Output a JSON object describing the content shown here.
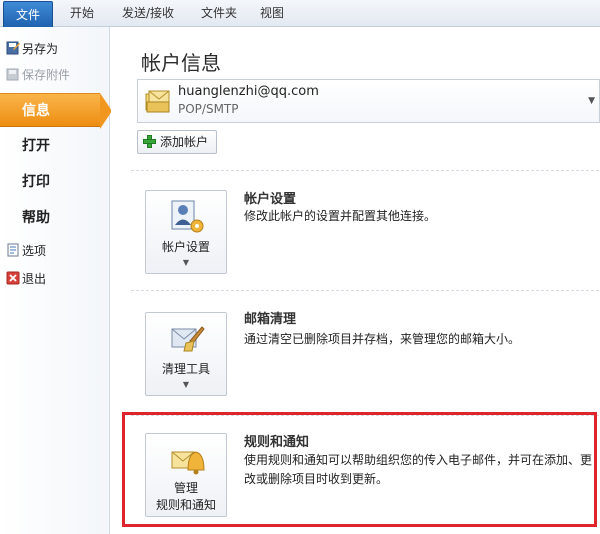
{
  "tabs": [
    {
      "label": "文件"
    },
    {
      "label": "开始"
    },
    {
      "label": "发送/接收"
    },
    {
      "label": "文件夹"
    },
    {
      "label": "视图"
    }
  ],
  "sidebar": {
    "save_as": "另存为",
    "save_attachments": "保存附件",
    "info": "信息",
    "open": "打开",
    "print": "打印",
    "help": "帮助",
    "options": "选项",
    "exit": "退出"
  },
  "main": {
    "title": "帐户信息",
    "account": {
      "email": "huanglenzhi@qq.com",
      "type": "POP/SMTP"
    },
    "add_account": "添加帐户",
    "sections": [
      {
        "button_line1": "帐户设置",
        "title": "帐户设置",
        "description": "修改此帐户的设置并配置其他连接。"
      },
      {
        "button_line1": "清理工具",
        "title": "邮箱清理",
        "description": "通过清空已删除项目并存档，来管理您的邮箱大小。"
      },
      {
        "button_line1": "管理",
        "button_line2": "规则和通知",
        "title": "规则和通知",
        "description": "使用规则和通知可以帮助组织您的传入电子邮件，并可在添加、更改或删除项目时收到更新。"
      }
    ]
  },
  "colors": {
    "file_tab": "#2a6fc0",
    "active_item": "#f1971f",
    "highlight": "#e0242b"
  }
}
